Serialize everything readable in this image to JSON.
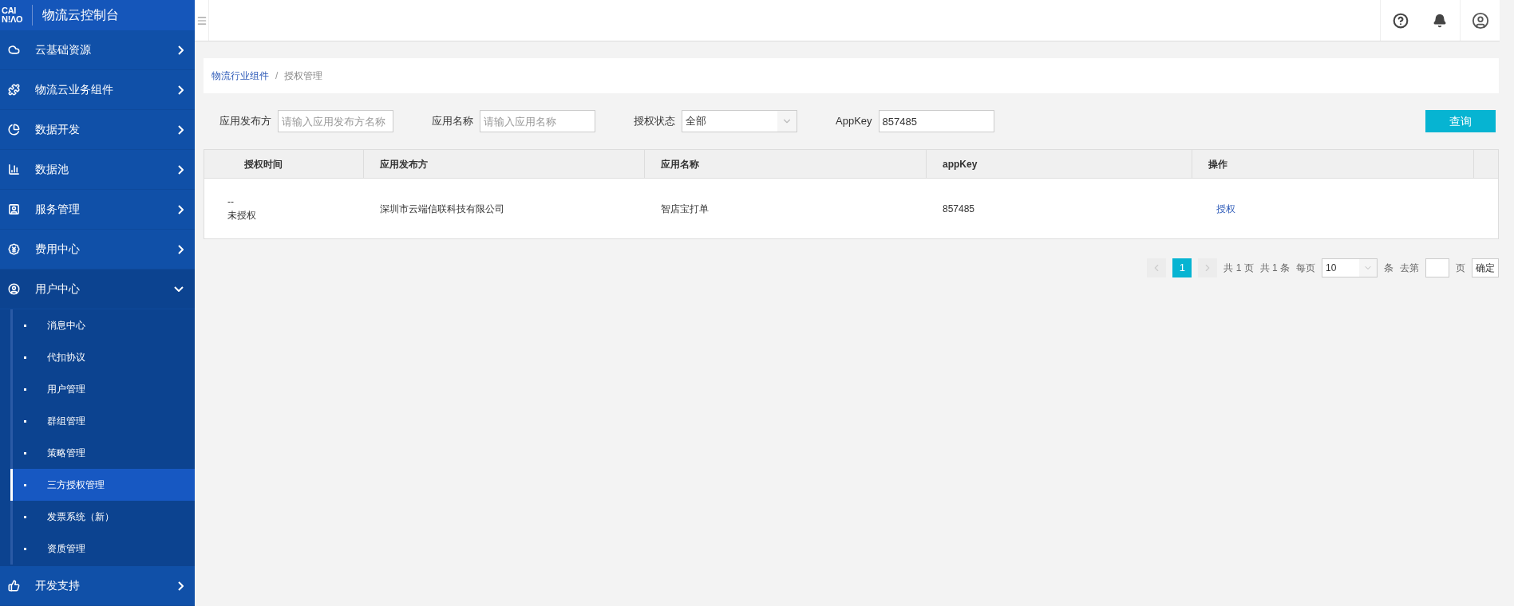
{
  "brand": {
    "logo_top": "CAI",
    "logo_bottom": "N!ΛO",
    "title": "物流云控制台"
  },
  "sidebar": {
    "items": [
      {
        "label": "云基础资源",
        "expanded": false
      },
      {
        "label": "物流云业务组件",
        "expanded": false
      },
      {
        "label": "数据开发",
        "expanded": false
      },
      {
        "label": "数据池",
        "expanded": false
      },
      {
        "label": "服务管理",
        "expanded": false
      },
      {
        "label": "费用中心",
        "expanded": false
      },
      {
        "label": "用户中心",
        "expanded": true,
        "children": [
          {
            "label": "消息中心",
            "selected": false
          },
          {
            "label": "代扣协议",
            "selected": false
          },
          {
            "label": "用户管理",
            "selected": false
          },
          {
            "label": "群组管理",
            "selected": false
          },
          {
            "label": "策略管理",
            "selected": false
          },
          {
            "label": "三方授权管理",
            "selected": true
          },
          {
            "label": "发票系统（新）",
            "selected": false
          },
          {
            "label": "资质管理",
            "selected": false
          }
        ]
      },
      {
        "label": "开发支持",
        "expanded": false
      }
    ]
  },
  "breadcrumb": {
    "separator": "/",
    "items": [
      "物流行业组件",
      "授权管理"
    ]
  },
  "filters": [
    {
      "kind": "input",
      "label": "应用发布方",
      "placeholder": "请输入应用发布方名称"
    },
    {
      "kind": "input",
      "label": "应用名称",
      "placeholder": "请输入应用名称"
    },
    {
      "kind": "select",
      "label": "授权状态",
      "value": "全部"
    },
    {
      "kind": "input",
      "label": "AppKey",
      "value": "857485"
    }
  ],
  "query_button": "查询",
  "table": {
    "columns": [
      "授权时间",
      "应用发布方",
      "应用名称",
      "appKey",
      "操作"
    ],
    "rows": [
      {
        "time": "--",
        "status": "未授权",
        "publisher": "深圳市云端信联科技有限公司",
        "app": "智店宝打单",
        "appkey": "857485",
        "action": "授权"
      }
    ]
  },
  "pagination": {
    "pages": [
      {
        "label": "1",
        "selected": true
      }
    ],
    "total_pages": "共 1 页",
    "total_items": "共 1 条",
    "per_page_label": "每页",
    "per_page": "10",
    "unit": "条",
    "goto_label": "去第",
    "page_unit": "页",
    "confirm": "确定"
  }
}
